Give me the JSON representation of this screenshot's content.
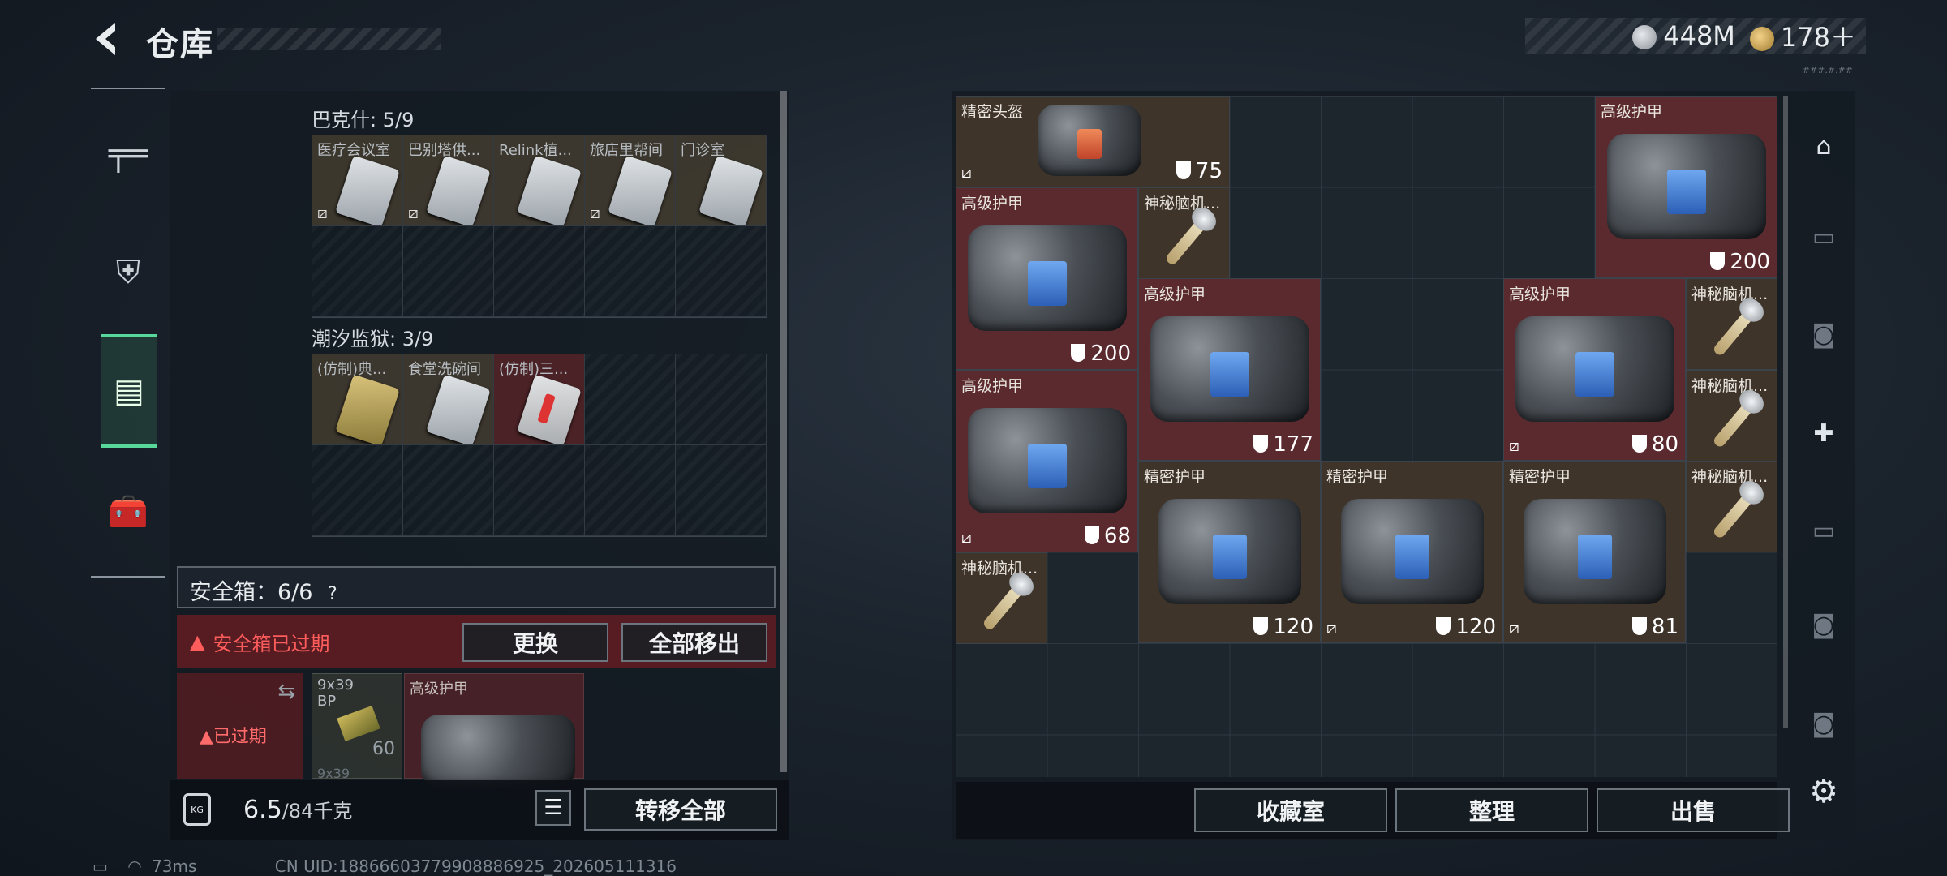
{
  "header": {
    "title": "仓库",
    "currency": [
      {
        "icon": "silver-coin-icon",
        "value": "448M"
      },
      {
        "icon": "gold-coin-icon",
        "value": "178＋"
      }
    ],
    "version_tag": "###.#.##"
  },
  "nav": {
    "items": [
      {
        "name": "weapon",
        "icon": "╤═"
      },
      {
        "name": "armor",
        "icon": "⛨"
      },
      {
        "name": "backpack",
        "icon": "▤"
      },
      {
        "name": "toolbox",
        "icon": "🧰"
      }
    ]
  },
  "left": {
    "sections": [
      {
        "label": "巴克什: 5/9",
        "cells": [
          {
            "label": "医疗会议室",
            "style": "card"
          },
          {
            "label": "巴别塔供...",
            "style": "card"
          },
          {
            "label": "Relink植...",
            "style": "card"
          },
          {
            "label": "旅店里帮间",
            "style": "card"
          },
          {
            "label": "门诊室",
            "style": "card"
          }
        ]
      },
      {
        "label": "潮汐监狱: 3/9",
        "cells": [
          {
            "label": "(仿制)典...",
            "style": "yel"
          },
          {
            "label": "食堂洗碗间",
            "style": "card"
          },
          {
            "label": "(仿制)三...",
            "style": "redc"
          }
        ]
      }
    ],
    "safebox": {
      "label": "安全箱：6/6",
      "help": "?"
    },
    "expired": {
      "text": "安全箱已过期",
      "replace": "更换",
      "move_all": "全部移出"
    },
    "safe_slot": {
      "text": "已过期"
    },
    "safe_items": [
      {
        "name": "9x39 BP",
        "count": "60",
        "sub": "9x39"
      },
      {
        "name": "高级护甲"
      }
    ],
    "footer": {
      "weight_value": "6.5",
      "weight_unit": "/84千克",
      "kg_label": "KG",
      "transfer_all": "转移全部"
    }
  },
  "right": {
    "items": [
      {
        "name": "精密头盔",
        "durability": "75",
        "color": "brown",
        "nodrop": true
      },
      {
        "name": "高级护甲",
        "durability": "200",
        "color": "maroon"
      },
      {
        "name": "神秘脑机...",
        "color": "brown"
      },
      {
        "name": "高级护甲",
        "durability": "200",
        "color": "maroon"
      },
      {
        "name": "高级护甲",
        "durability": "177",
        "color": "maroon"
      },
      {
        "name": "高级护甲",
        "durability": "80",
        "color": "maroon",
        "nodrop": true
      },
      {
        "name": "神秘脑机...",
        "color": "brown"
      },
      {
        "name": "高级护甲",
        "durability": "68",
        "color": "maroon",
        "nodrop": true
      },
      {
        "name": "神秘脑机...",
        "color": "brown"
      },
      {
        "name": "精密护甲",
        "durability": "120",
        "color": "brown"
      },
      {
        "name": "精密护甲",
        "durability": "120",
        "color": "brown",
        "nodrop": true
      },
      {
        "name": "精密护甲",
        "durability": "81",
        "color": "brown",
        "nodrop": true
      },
      {
        "name": "神秘脑机...",
        "color": "brown"
      },
      {
        "name": "神秘脑机...",
        "color": "brown"
      }
    ],
    "footer": {
      "collection": "收藏室",
      "sort": "整理",
      "sell": "出售"
    },
    "side_icons": [
      "home-icon",
      "iv-folder-icon",
      "iv-camera-icon",
      "iv-medkit-add-icon",
      "iv-folder-icon",
      "iv-camera-icon",
      "iv-camera-icon",
      "settings-icon"
    ]
  },
  "status": {
    "ping": "73ms",
    "uid": "CN UID:18866603779908886925_202605111316"
  }
}
